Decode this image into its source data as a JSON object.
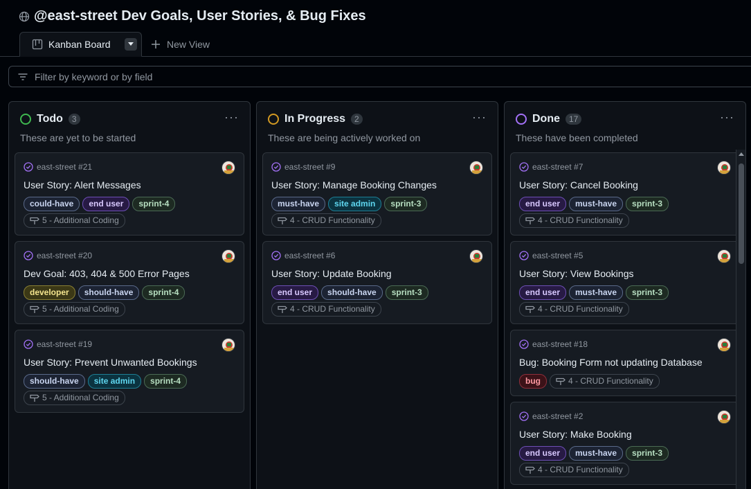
{
  "header": {
    "title": "@east-street Dev Goals, User Stories, & Bug Fixes"
  },
  "tabs": {
    "active_label": "Kanban Board",
    "new_view_label": "New View"
  },
  "filter": {
    "placeholder": "Filter by keyword or by field"
  },
  "colors": {
    "todo": "#3fb950",
    "in_progress": "#d29922",
    "done": "#a371f7",
    "label_could_have": {
      "bg": "#1c2333",
      "border": "#5a6a8a",
      "text": "#c9d5f0"
    },
    "label_end_user": {
      "bg": "#271a44",
      "border": "#6e4fb6",
      "text": "#d9c9ff"
    },
    "label_sprint": {
      "bg": "#1d2a22",
      "border": "#4b6b55",
      "text": "#b7dfc1"
    },
    "label_site_admin": {
      "bg": "#0b3340",
      "border": "#1e7f95",
      "text": "#5fd7f0"
    },
    "label_developer": {
      "bg": "#3b3816",
      "border": "#8a8033",
      "text": "#f4e58f"
    },
    "label_bug": {
      "bg": "#3b1218",
      "border": "#8e2f3b",
      "text": "#ff9aa2"
    }
  },
  "columns": [
    {
      "name": "Todo",
      "count": "3",
      "description": "These are yet to be started",
      "cards": [
        {
          "ref": "east-street #21",
          "title": "User Story: Alert Messages",
          "labels": [
            "could-have",
            "end user",
            "sprint-4"
          ],
          "milestone": "5 - Additional Coding"
        },
        {
          "ref": "east-street #20",
          "title": "Dev Goal: 403, 404 & 500 Error Pages",
          "labels": [
            "developer",
            "should-have",
            "sprint-4"
          ],
          "milestone": "5 - Additional Coding"
        },
        {
          "ref": "east-street #19",
          "title": "User Story: Prevent Unwanted Bookings",
          "labels": [
            "should-have",
            "site admin",
            "sprint-4"
          ],
          "milestone": "5 - Additional Coding"
        }
      ]
    },
    {
      "name": "In Progress",
      "count": "2",
      "description": "These are being actively worked on",
      "cards": [
        {
          "ref": "east-street #9",
          "title": "User Story: Manage Booking Changes",
          "labels": [
            "must-have",
            "site admin",
            "sprint-3"
          ],
          "milestone": "4 - CRUD Functionality"
        },
        {
          "ref": "east-street #6",
          "title": "User Story: Update Booking",
          "labels": [
            "end user",
            "should-have",
            "sprint-3"
          ],
          "milestone": "4 - CRUD Functionality"
        }
      ]
    },
    {
      "name": "Done",
      "count": "17",
      "description": "These have been completed",
      "cards": [
        {
          "ref": "east-street #7",
          "title": "User Story: Cancel Booking",
          "labels": [
            "end user",
            "must-have",
            "sprint-3"
          ],
          "milestone": "4 - CRUD Functionality"
        },
        {
          "ref": "east-street #5",
          "title": "User Story: View Bookings",
          "labels": [
            "end user",
            "must-have",
            "sprint-3"
          ],
          "milestone": "4 - CRUD Functionality"
        },
        {
          "ref": "east-street #18",
          "title": "Bug: Booking Form not updating Database",
          "labels": [
            "bug"
          ],
          "milestone": "4 - CRUD Functionality"
        },
        {
          "ref": "east-street #2",
          "title": "User Story: Make Booking",
          "labels": [
            "end user",
            "must-have",
            "sprint-3"
          ],
          "milestone": "4 - CRUD Functionality"
        }
      ]
    }
  ]
}
